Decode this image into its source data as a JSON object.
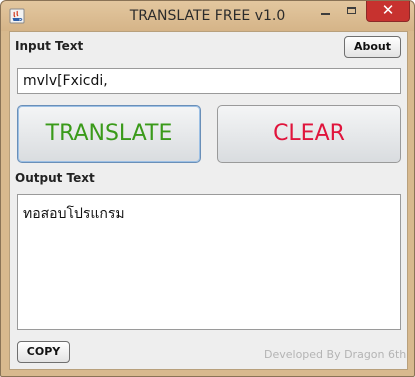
{
  "window": {
    "title": "TRANSLATE FREE v1.0",
    "icon": "java-cup-icon",
    "controls": {
      "minimize": "minimize",
      "maximize": "maximize",
      "close": "✕"
    }
  },
  "input": {
    "label": "Input Text",
    "value": "mvlv[Fxicdi,"
  },
  "about_button": "About",
  "translate_button": "TRANSLATE",
  "clear_button": "CLEAR",
  "output": {
    "label": "Output Text",
    "value": "ทอสอบโปรแกรม"
  },
  "copy_button": "COPY",
  "credit": "Developed By Dragon 6th",
  "colors": {
    "translate_text": "#3a9a1a",
    "clear_text": "#e0143c",
    "titlebar": "#d5b488",
    "close_button": "#c7322f"
  }
}
